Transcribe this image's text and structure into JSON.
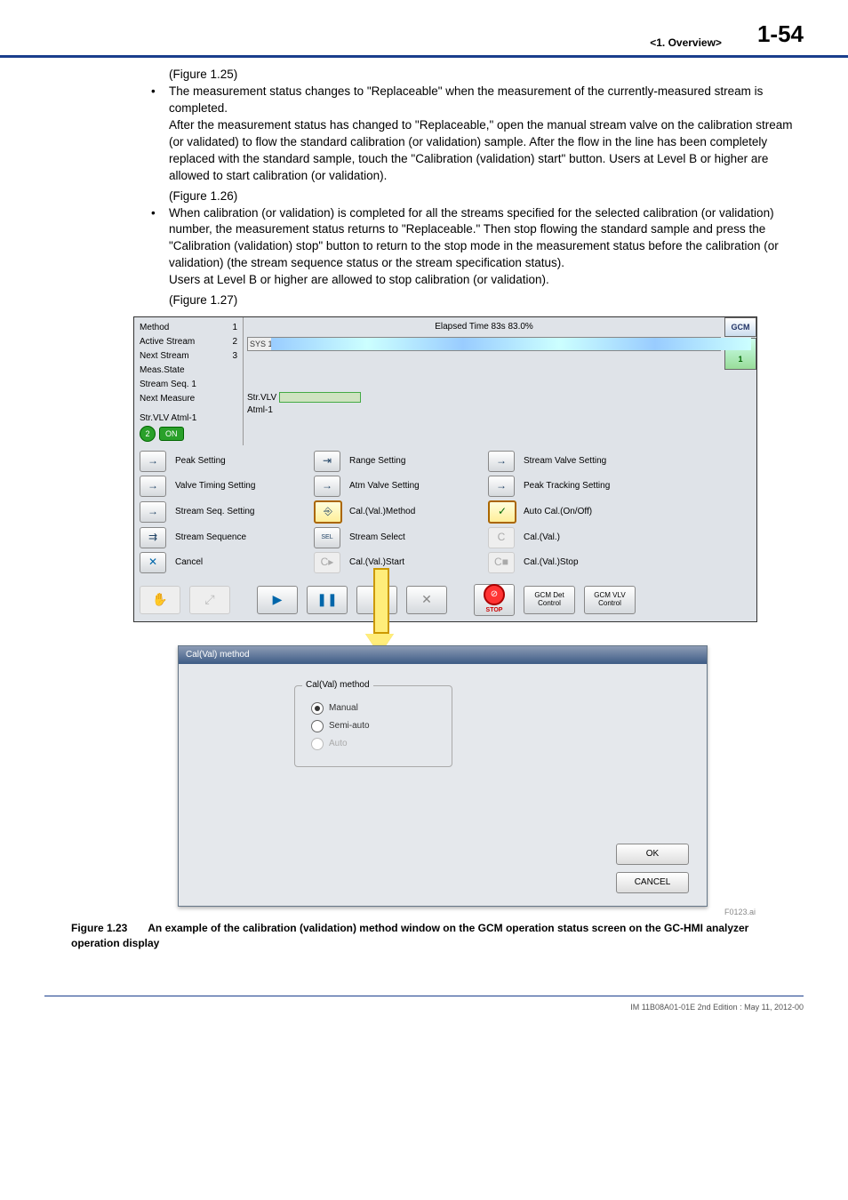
{
  "header": {
    "section": "<1.  Overview>",
    "page_number": "1-54"
  },
  "body": {
    "fig_ref_125": "(Figure 1.25)",
    "bullet1": "The measurement status changes to \"Replaceable\" when the measurement of the currently-measured stream is completed.",
    "para1": "After the measurement status has changed to \"Replaceable,\" open the manual stream valve on the calibration stream (or validated) to flow the standard calibration (or validation) sample. After the flow in the line has been completely replaced with the standard sample, touch the \"Calibration (validation) start\" button. Users at Level B or higher are allowed to start calibration (or validation).",
    "fig_ref_126": "(Figure 1.26)",
    "bullet2": "When calibration (or validation) is completed for all the streams specified for the selected calibration (or validation) number, the measurement status returns to \"Replaceable.\" Then stop flowing the standard sample and press the \"Calibration (validation) stop\" button to return to the stop mode in the measurement status before the calibration (or validation) (the stream sequence status or the stream specification status).",
    "para2": "Users at Level B or higher are allowed to stop calibration (or validation).",
    "fig_ref_127": "(Figure 1.27)"
  },
  "app": {
    "status": {
      "k1": "Method",
      "v1": "1",
      "k2": "Active Stream",
      "v2": "2",
      "k3": "Next Stream",
      "v3": "3",
      "k4": "Meas.State",
      "k5": "Stream Seq. 1",
      "k6": "Next Measure",
      "k7": "Str.VLV Atml-1",
      "on_num": "2",
      "on_text": "ON",
      "strvlv_lbl1": "Str.VLV",
      "strvlv_lbl2": "Atml-1"
    },
    "elapsed": "Elapsed Time  83s  83.0%",
    "sys1": "SYS 1",
    "tabs": {
      "gcm": "GCM",
      "sys": "SYS\n1"
    },
    "buttons": {
      "r1c1": "Peak Setting",
      "r1c2": "Range Setting",
      "r1c3": "Stream Valve Setting",
      "r2c1": "Valve Timing Setting",
      "r2c2": "Atm Valve Setting",
      "r2c3": "Peak Tracking Setting",
      "r3c1": "Stream Seq. Setting",
      "r3c2": "Cal.(Val.)Method",
      "r3c3": "Auto Cal.(On/Off)",
      "r4c1": "Stream Sequence",
      "r4c2": "Stream Select",
      "r4c3": "Cal.(Val.)",
      "r5c1": "Cancel",
      "r5c2": "Cal.(Val.)Start",
      "r5c3": "Cal.(Val.)Stop"
    },
    "transport": {
      "stop_caption": "STOP",
      "gcm_det": "GCM Det\nControl",
      "gcm_vlv": "GCM VLV\nControl"
    }
  },
  "dialog": {
    "title": "Cal(Val) method",
    "group": "Cal(Val) method",
    "opt1": "Manual",
    "opt2": "Semi-auto",
    "opt3": "Auto",
    "ok": "OK",
    "cancel": "CANCEL"
  },
  "fig_num": "F0123.ai",
  "caption_lead": "Figure 1.23",
  "caption_text": "An example of the calibration (validation) method window on the GCM operation status screen on the GC-HMI analyzer operation display",
  "footer": "IM 11B08A01-01E     2nd Edition : May 11, 2012-00"
}
